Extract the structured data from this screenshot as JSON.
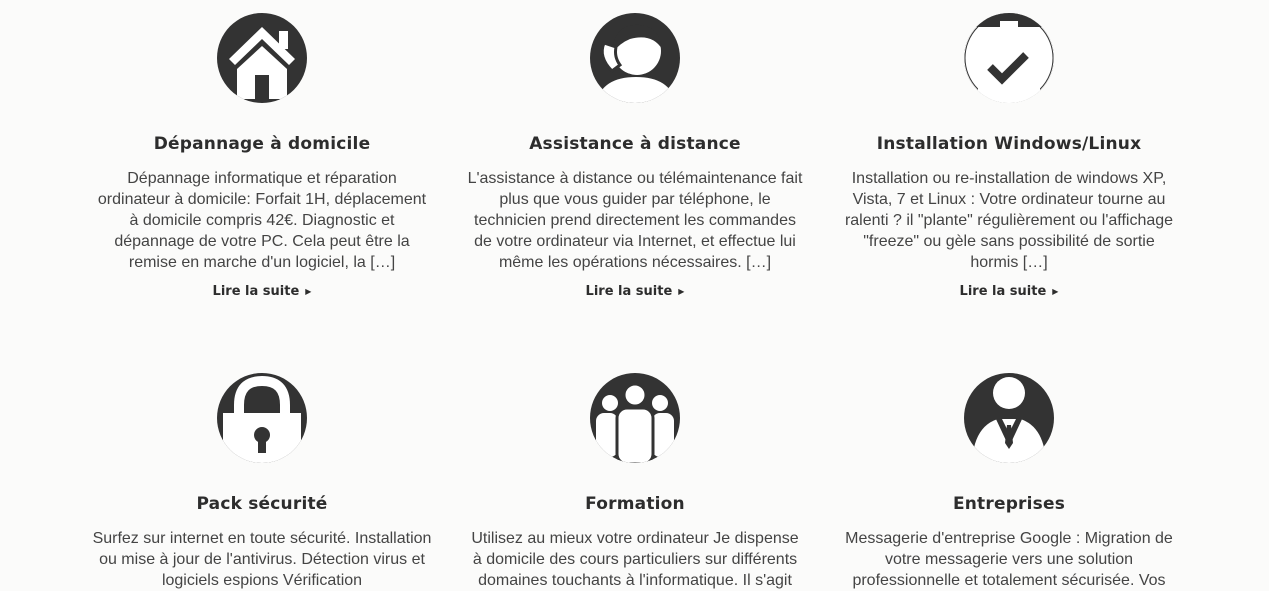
{
  "services": [
    {
      "icon": "home-icon",
      "title": "Dépannage à domicile",
      "description": "Dépannage informatique et réparation ordinateur à domicile: Forfait 1H, déplacement à domicile compris 42€. Diagnostic et dépannage de votre PC. Cela peut être la remise en marche d'un logiciel, la […]",
      "read_more": "Lire la suite"
    },
    {
      "icon": "headset-support-icon",
      "title": "Assistance à distance",
      "description": "L'assistance à distance ou télémaintenance fait plus que vous guider par téléphone, le technicien prend directement les commandes de votre ordinateur via Internet, et effectue lui même les opérations nécessaires. […]",
      "read_more": "Lire la suite"
    },
    {
      "icon": "clipboard-check-icon",
      "title": "Installation Windows/Linux",
      "description": "Installation ou re-installation de windows XP, Vista, 7 et Linux : Votre ordinateur tourne au ralenti ? il \"plante\" régulièrement ou l'affichage \"freeze\" ou gèle sans possibilité de sortie hormis […]",
      "read_more": "Lire la suite"
    },
    {
      "icon": "padlock-icon",
      "title": "Pack sécurité",
      "description": "Surfez sur internet en toute sécurité. Installation ou mise à jour de l'antivirus. Détection virus et logiciels espions Vérification"
    },
    {
      "icon": "group-icon",
      "title": "Formation",
      "description": "Utilisez au mieux votre ordinateur Je dispense à domicile des cours particuliers sur différents domaines touchants à l'informatique. Il s'agit"
    },
    {
      "icon": "businessman-icon",
      "title": "Entreprises",
      "description": "Messagerie d'entreprise Google : Migration de votre messagerie vers une solution professionnelle et totalement sécurisée. Vos"
    }
  ]
}
